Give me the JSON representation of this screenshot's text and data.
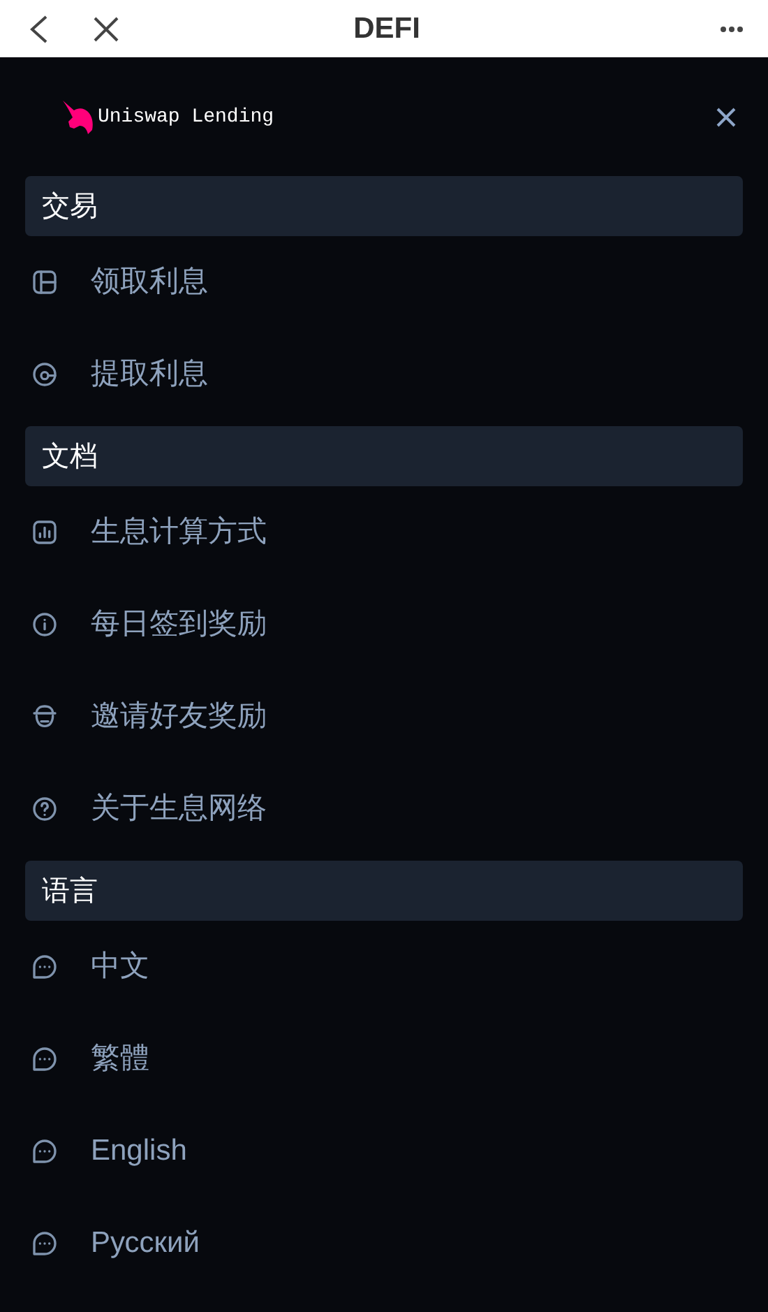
{
  "top_bar": {
    "title": "DEFI"
  },
  "brand": {
    "name": "Uniswap Lending"
  },
  "sections": [
    {
      "title": "交易",
      "items": [
        {
          "kind": "layout",
          "label": "领取利息"
        },
        {
          "kind": "pie",
          "label": "提取利息"
        }
      ]
    },
    {
      "title": "文档",
      "items": [
        {
          "kind": "chart",
          "label": "生息计算方式"
        },
        {
          "kind": "info",
          "label": "每日签到奖励"
        },
        {
          "kind": "face",
          "label": "邀请好友奖励"
        },
        {
          "kind": "help",
          "label": "关于生息网络"
        }
      ]
    },
    {
      "title": "语言",
      "items": [
        {
          "kind": "chat",
          "label": "中文"
        },
        {
          "kind": "chat",
          "label": "繁體"
        },
        {
          "kind": "chat",
          "label": "English"
        },
        {
          "kind": "chat",
          "label": "Русский"
        }
      ]
    }
  ]
}
